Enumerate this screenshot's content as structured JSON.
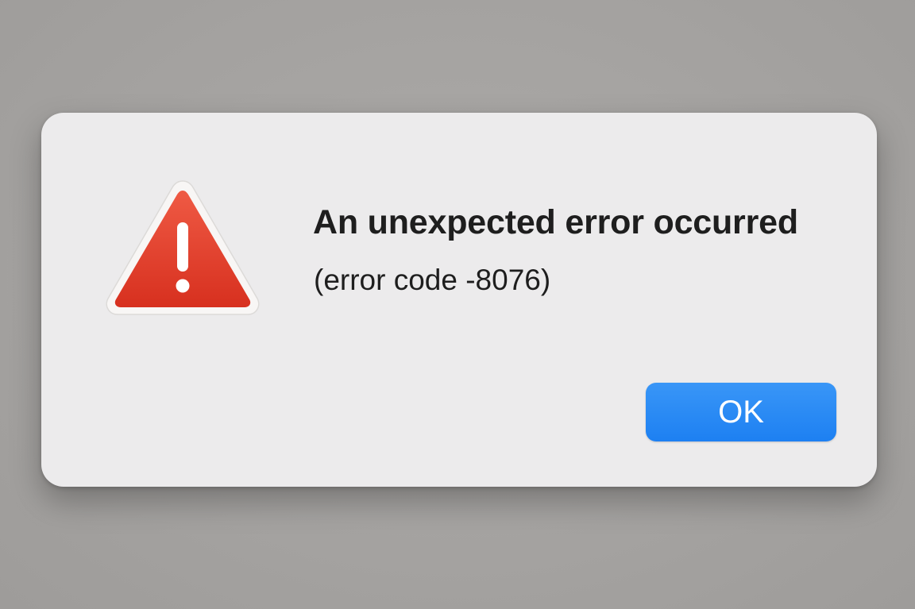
{
  "dialog": {
    "icon": "warning-triangle-icon",
    "title": "An unexpected error occurred",
    "message": "(error code -8076)",
    "ok_label": "OK"
  },
  "colors": {
    "background": "#a5a3a1",
    "dialog": "#ecebec",
    "warning_red": "#e2402f",
    "button_blue": "#2a8af5",
    "text": "#1e1e1e"
  }
}
